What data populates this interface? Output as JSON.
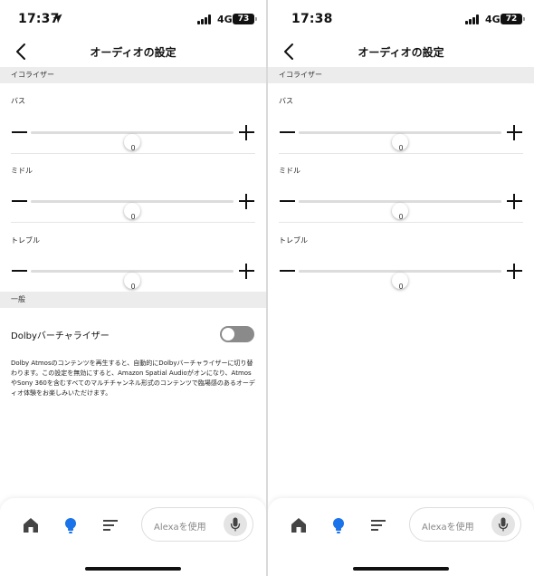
{
  "screens": [
    {
      "status": {
        "time": "17:37",
        "network": "4G",
        "battery": "73"
      },
      "nav": {
        "title": "オーディオの設定"
      },
      "equalizer": {
        "header": "イコライザー",
        "bands": [
          {
            "label": "バス",
            "value": "0",
            "level_fraction": 0.5
          },
          {
            "label": "ミドル",
            "value": "0",
            "level_fraction": 0.5
          },
          {
            "label": "トレブル",
            "value": "0",
            "level_fraction": 0.5
          }
        ]
      },
      "general": {
        "header": "一般",
        "dolby_label": "Dolbyバーチャライザー",
        "dolby_enabled": false,
        "description": "Dolby Atmosのコンテンツを再生すると、自動的にDolbyバーチャライザーに切り替わります。この設定を無効にすると、Amazon Spatial Audioがオンになり、AtmosやSony 360を含むすべてのマルチチャンネル形式のコンテンツで臨場感のあるオーディオ体験をお楽しみいただけます。"
      },
      "bottom_nav": {
        "alexa_placeholder": "Alexaを使用",
        "active_tab": "devices"
      }
    },
    {
      "status": {
        "time": "17:38",
        "network": "4G",
        "battery": "72"
      },
      "nav": {
        "title": "オーディオの設定"
      },
      "equalizer": {
        "header": "イコライザー",
        "bands": [
          {
            "label": "バス",
            "value": "0",
            "level_fraction": 0.5
          },
          {
            "label": "ミドル",
            "value": "0",
            "level_fraction": 0.5
          },
          {
            "label": "トレブル",
            "value": "0",
            "level_fraction": 0.5
          }
        ]
      },
      "bottom_nav": {
        "alexa_placeholder": "Alexaを使用",
        "active_tab": "devices"
      }
    }
  ],
  "colors": {
    "accent": "#1a73e8",
    "toggle_off": "#8a8a8a",
    "section_bg": "#ececec"
  },
  "icons": [
    "location-arrow-icon",
    "signal-icon",
    "battery-icon",
    "back-chevron-icon",
    "home-icon",
    "devices-bulb-icon",
    "list-icon",
    "microphone-icon"
  ]
}
